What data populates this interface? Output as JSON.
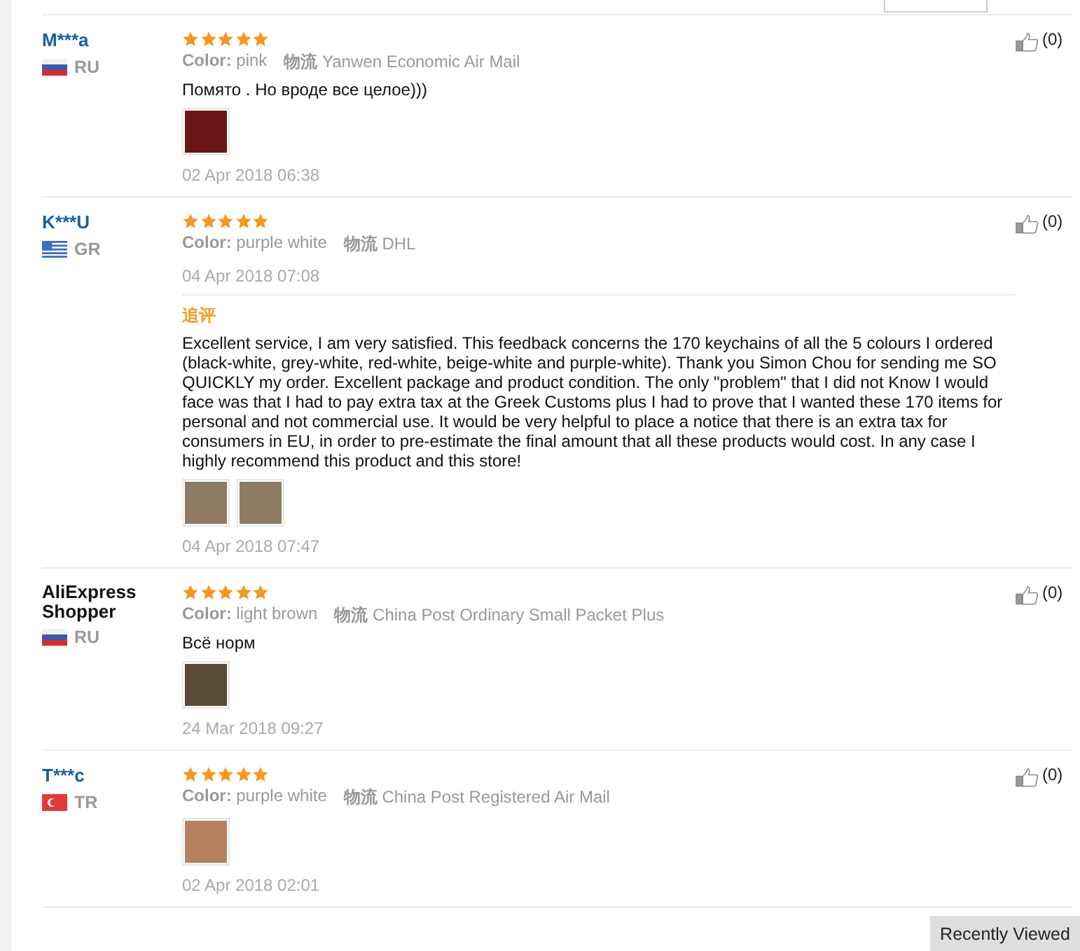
{
  "reviews": [
    {
      "user": "M***a",
      "country": "RU",
      "stars": 5,
      "color_label": "Color:",
      "color_value": "pink",
      "logistics_label": "物流",
      "logistics": "Yanwen Economic Air Mail",
      "text": "Помято . Но вроде все целое)))",
      "photos": [
        {
          "kind": "photo"
        }
      ],
      "date": "02 Apr 2018 06:38",
      "likes": "(0)"
    },
    {
      "user": "K***U",
      "country": "GR",
      "stars": 5,
      "color_label": "Color:",
      "color_value": "purple white",
      "logistics_label": "物流",
      "logistics": "DHL",
      "date": "04 Apr 2018 07:08",
      "likes": "(0)",
      "followup": {
        "label": "追评",
        "text": "Excellent service, I am very satisfied. This feedback concerns the 170 keychains of all the 5 colours I ordered (black-white, grey-white, red-white, beige-white and purple-white). Thank you Simon Chou for sending me SO QUICKLY my order. Excellent package and product condition. The only \"problem\" that I did not Know I would face was that I had to pay extra tax at the Greek Customs plus I had to prove that I wanted these 170 items for personal and not commercial use. It would be very helpful to place a notice that there is an extra tax for consumers in EU, in order to pre-estimate the final amount that all these products would cost. In any case I highly recommend this product and this store!",
        "photos": [
          {
            "kind": "photo"
          },
          {
            "kind": "photo"
          }
        ],
        "date": "04 Apr 2018 07:47"
      }
    },
    {
      "user": "AliExpress Shopper",
      "country": "RU",
      "stars": 5,
      "color_label": "Color:",
      "color_value": "light brown",
      "logistics_label": "物流",
      "logistics": "China Post Ordinary Small Packet Plus",
      "text": "Всё норм",
      "photos": [
        {
          "kind": "photo"
        }
      ],
      "date": "24 Mar 2018 09:27",
      "likes": "(0)"
    },
    {
      "user": "T***c",
      "country": "TR",
      "stars": 5,
      "color_label": "Color:",
      "color_value": "purple white",
      "logistics_label": "物流",
      "logistics": "China Post Registered Air Mail",
      "photos": [
        {
          "kind": "photo"
        }
      ],
      "date": "02 Apr 2018 02:01",
      "likes": "(0)"
    }
  ],
  "recently_viewed": "Recently Viewed"
}
